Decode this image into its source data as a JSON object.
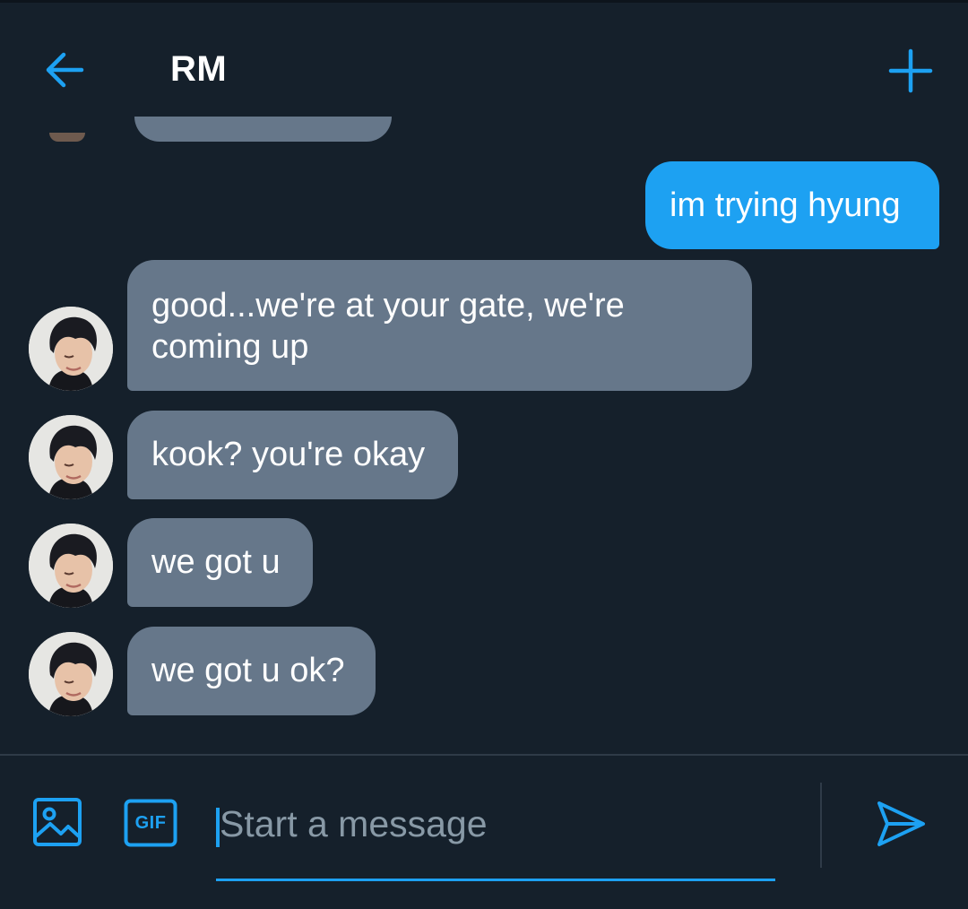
{
  "header": {
    "title": "RM",
    "back_icon": "arrow-left-icon",
    "new_icon": "plus-icon"
  },
  "colors": {
    "background": "#15202b",
    "accent": "#1da1f2",
    "incoming_bubble": "#66778a",
    "placeholder": "#8899a6"
  },
  "messages": [
    {
      "direction": "in",
      "text": ""
    },
    {
      "direction": "out",
      "text": "im trying hyung"
    },
    {
      "direction": "in",
      "text": "good...we're at your gate, we're coming up"
    },
    {
      "direction": "in",
      "text": "kook? you're okay"
    },
    {
      "direction": "in",
      "text": "we got u"
    },
    {
      "direction": "in",
      "text": "we got u ok?"
    }
  ],
  "composer": {
    "placeholder": "Start a message",
    "value": "",
    "media_icon": "image-icon",
    "gif_label": "GIF",
    "send_icon": "send-icon"
  }
}
